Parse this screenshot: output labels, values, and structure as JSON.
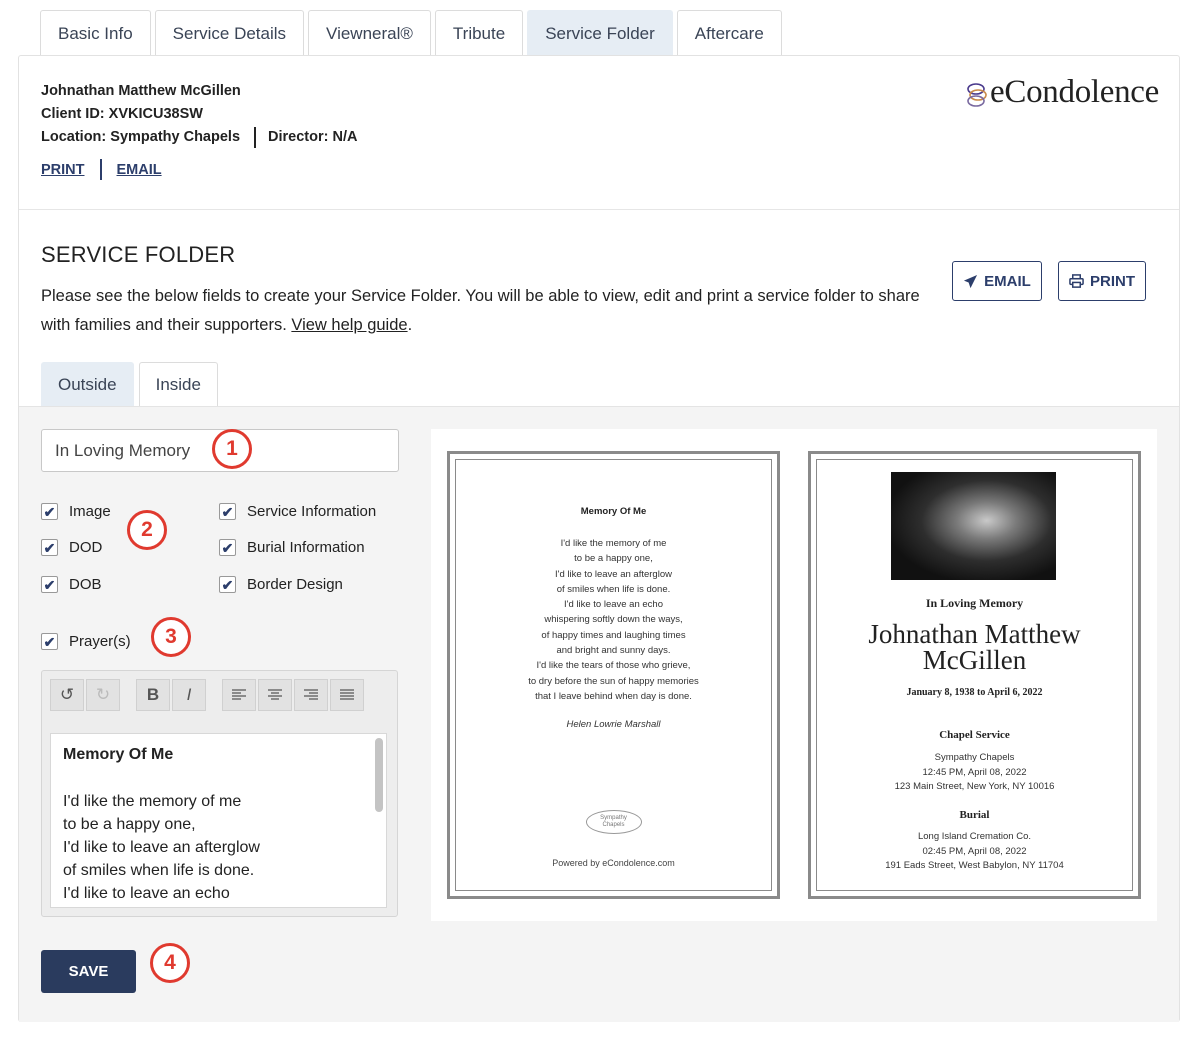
{
  "tabs": [
    "Basic Info",
    "Service Details",
    "Viewneral®",
    "Tribute",
    "Service Folder",
    "Aftercare"
  ],
  "active_tab": "Service Folder",
  "client": {
    "name": "Johnathan Matthew McGillen",
    "client_id": "Client ID: XVKICU38SW",
    "location": "Location: Sympathy Chapels",
    "director": "Director: N/A"
  },
  "header_links": {
    "print": "PRINT",
    "email": "EMAIL"
  },
  "logo": {
    "text": "eCondolence"
  },
  "service_folder": {
    "title": "SERVICE FOLDER",
    "description": "Please see the below fields to create your Service Folder. You will be able to view, edit and print a service folder to share with families and their supporters.",
    "help_link": "View help guide",
    "email_button": "EMAIL",
    "print_button": "PRINT"
  },
  "subtabs": [
    "Outside",
    "Inside"
  ],
  "active_subtab": "Outside",
  "form": {
    "title_value": "In Loving Memory",
    "checkboxes": {
      "image": "Image",
      "dod": "DOD",
      "dob": "DOB",
      "service_info": "Service Information",
      "burial_info": "Burial Information",
      "border_design": "Border Design",
      "prayers": "Prayer(s)"
    },
    "save_label": "SAVE"
  },
  "badges": [
    "1",
    "2",
    "3",
    "4"
  ],
  "editor": {
    "heading": "Memory Of Me",
    "lines": [
      "I'd like the memory of me",
      "to be a happy one,",
      "I'd like to leave an afterglow",
      "of smiles when life is done.",
      "I'd like to leave an echo"
    ]
  },
  "preview": {
    "back": {
      "poem_title": "Memory Of Me",
      "poem_lines": [
        "I'd like the memory of me",
        "to be a happy one,",
        "I'd like to leave an afterglow",
        "of smiles when life is done.",
        "I'd like to leave an echo",
        "whispering softly down the ways,",
        "of happy times and laughing times",
        "and bright and sunny days.",
        "I'd like the tears of those who grieve,",
        "to dry before the sun of happy memories",
        "that I leave behind when day is done."
      ],
      "author": "Helen Lowrie Marshall",
      "logo_line1": "Sympathy",
      "logo_line2": "Chapels",
      "powered": "Powered by eCondolence.com"
    },
    "front": {
      "heading": "In Loving Memory",
      "name_line1": "Johnathan Matthew",
      "name_line2": "McGillen",
      "dates": "January 8, 1938 to April 6, 2022",
      "service_title": "Chapel Service",
      "service_lines": [
        "Sympathy Chapels",
        "12:45 PM, April 08, 2022",
        "123 Main Street, New York, NY 10016"
      ],
      "burial_title": "Burial",
      "burial_lines": [
        "Long Island Cremation Co.",
        "02:45 PM, April 08, 2022",
        "191 Eads Street, West Babylon, NY 11704"
      ]
    }
  },
  "colors": {
    "navy": "#2a3b5e",
    "badge_red": "#e03a2f",
    "active_tab_bg": "#e6edf4"
  }
}
